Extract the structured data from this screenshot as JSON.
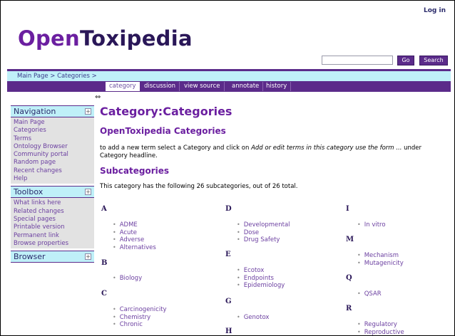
{
  "header": {
    "login": "Log in",
    "logo_part1": "Open",
    "logo_part2": "Toxipedia",
    "search_placeholder": "",
    "go_label": "Go",
    "search_label": "Search"
  },
  "breadcrumb": {
    "text": "Main Page > Categories >"
  },
  "tabs": [
    {
      "label": "category",
      "active": true
    },
    {
      "label": "discussion"
    },
    {
      "label": "view source"
    },
    {
      "label": "annotate"
    },
    {
      "label": "history"
    }
  ],
  "sidebar": {
    "navigation": {
      "title": "Navigation",
      "items": [
        "Main Page",
        "Categories",
        "Terms",
        "Ontology Browser",
        "Community portal",
        "Random page",
        "Recent changes",
        "Help"
      ]
    },
    "toolbox": {
      "title": "Toolbox",
      "items": [
        "What links here",
        "Related changes",
        "Special pages",
        "Printable version",
        "Permanent link",
        "Browse properties"
      ]
    },
    "browser": {
      "title": "Browser"
    }
  },
  "content": {
    "title": "Category:Categories",
    "section1": "OpenToxipedia Categories",
    "intro_a": "to add a new term select a Category and click on ",
    "intro_italic": "Add or edit terms in this category use the form ...",
    "intro_b": " under Category headline.",
    "section2": "Subcategories",
    "count_text": "This category has the following 26 subcategories, out of 26 total.",
    "groups": {
      "A": [
        "ADME",
        "Acute",
        "Adverse",
        "Alternatives"
      ],
      "B": [
        "Biology"
      ],
      "C": [
        "Carcinogenicity",
        "Chemistry",
        "Chronic"
      ],
      "D": [
        "Developmental",
        "Dose",
        "Drug Safety"
      ],
      "E": [
        "Ecotox",
        "Endpoints",
        "Epidemiology"
      ],
      "G": [
        "Genotox"
      ],
      "H": [],
      "I": [
        "In vitro"
      ],
      "M": [
        "Mechanism",
        "Mutagenicity"
      ],
      "Q": [
        "QSAR"
      ],
      "R": [
        "Regulatory",
        "Reproductive"
      ]
    },
    "letters": {
      "A": "A",
      "B": "B",
      "C": "C",
      "D": "D",
      "E": "E",
      "G": "G",
      "H": "H",
      "I": "I",
      "M": "M",
      "Q": "Q",
      "R": "R"
    }
  },
  "icons": {
    "toggle": "+",
    "resize": "⇔"
  }
}
